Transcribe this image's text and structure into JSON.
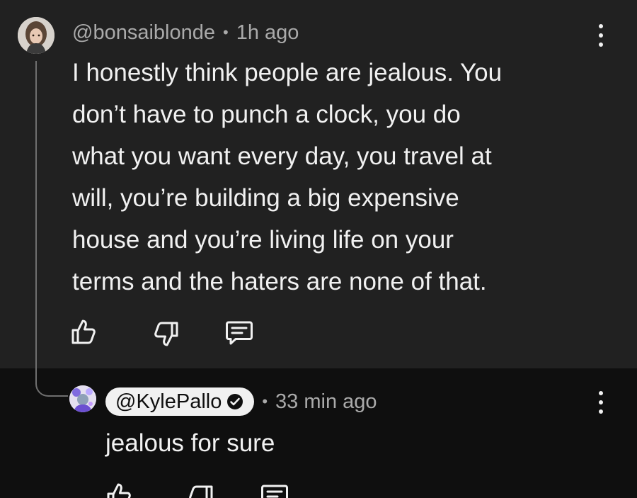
{
  "top_comment": {
    "author": "@bonsaiblonde",
    "separator": "•",
    "time_ago": "1h ago",
    "text_lines": [
      "I honestly think people are jealous.  You",
      "don’t have to punch a clock, you do",
      "what you want every day, you travel at",
      "will, you’re building a big expensive",
      "house and you’re living life on your",
      "terms and the haters are none of that."
    ],
    "icons": [
      "thumbs-up-icon",
      "thumbs-down-icon",
      "reply-icon",
      "more-options-icon"
    ]
  },
  "reply": {
    "author": "@KylePallo",
    "verified": true,
    "separator": "•",
    "time_ago": "33 min ago",
    "text": "jealous for sure",
    "icons": [
      "thumbs-up-icon",
      "thumbs-down-icon",
      "reply-icon",
      "more-options-icon"
    ]
  },
  "colors": {
    "top_comment_bg": "#212121",
    "reply_bg": "#0f0f0f",
    "text_primary": "#f1f1f1",
    "text_secondary": "#aaaaaa",
    "owner_pill": "#f1f1f1"
  }
}
